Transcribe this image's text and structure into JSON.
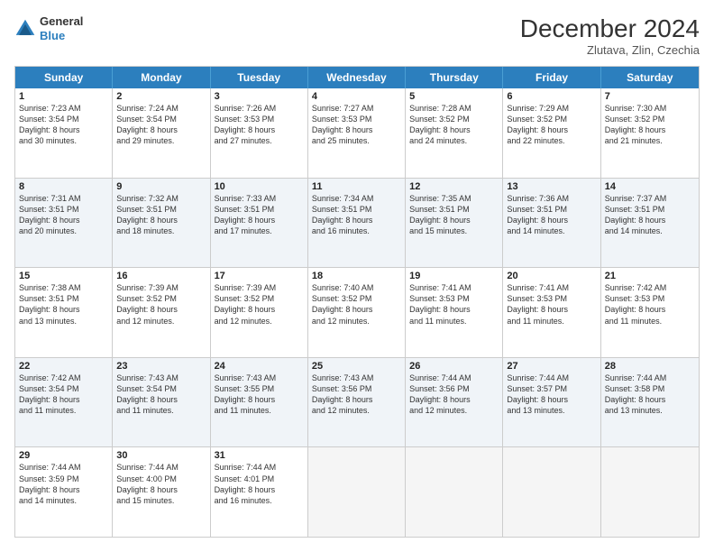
{
  "logo": {
    "general": "General",
    "blue": "Blue"
  },
  "title": "December 2024",
  "subtitle": "Zlutava, Zlin, Czechia",
  "header_days": [
    "Sunday",
    "Monday",
    "Tuesday",
    "Wednesday",
    "Thursday",
    "Friday",
    "Saturday"
  ],
  "weeks": [
    [
      {
        "day": "1",
        "lines": [
          "Sunrise: 7:23 AM",
          "Sunset: 3:54 PM",
          "Daylight: 8 hours",
          "and 30 minutes."
        ]
      },
      {
        "day": "2",
        "lines": [
          "Sunrise: 7:24 AM",
          "Sunset: 3:54 PM",
          "Daylight: 8 hours",
          "and 29 minutes."
        ]
      },
      {
        "day": "3",
        "lines": [
          "Sunrise: 7:26 AM",
          "Sunset: 3:53 PM",
          "Daylight: 8 hours",
          "and 27 minutes."
        ]
      },
      {
        "day": "4",
        "lines": [
          "Sunrise: 7:27 AM",
          "Sunset: 3:53 PM",
          "Daylight: 8 hours",
          "and 25 minutes."
        ]
      },
      {
        "day": "5",
        "lines": [
          "Sunrise: 7:28 AM",
          "Sunset: 3:52 PM",
          "Daylight: 8 hours",
          "and 24 minutes."
        ]
      },
      {
        "day": "6",
        "lines": [
          "Sunrise: 7:29 AM",
          "Sunset: 3:52 PM",
          "Daylight: 8 hours",
          "and 22 minutes."
        ]
      },
      {
        "day": "7",
        "lines": [
          "Sunrise: 7:30 AM",
          "Sunset: 3:52 PM",
          "Daylight: 8 hours",
          "and 21 minutes."
        ]
      }
    ],
    [
      {
        "day": "8",
        "lines": [
          "Sunrise: 7:31 AM",
          "Sunset: 3:51 PM",
          "Daylight: 8 hours",
          "and 20 minutes."
        ]
      },
      {
        "day": "9",
        "lines": [
          "Sunrise: 7:32 AM",
          "Sunset: 3:51 PM",
          "Daylight: 8 hours",
          "and 18 minutes."
        ]
      },
      {
        "day": "10",
        "lines": [
          "Sunrise: 7:33 AM",
          "Sunset: 3:51 PM",
          "Daylight: 8 hours",
          "and 17 minutes."
        ]
      },
      {
        "day": "11",
        "lines": [
          "Sunrise: 7:34 AM",
          "Sunset: 3:51 PM",
          "Daylight: 8 hours",
          "and 16 minutes."
        ]
      },
      {
        "day": "12",
        "lines": [
          "Sunrise: 7:35 AM",
          "Sunset: 3:51 PM",
          "Daylight: 8 hours",
          "and 15 minutes."
        ]
      },
      {
        "day": "13",
        "lines": [
          "Sunrise: 7:36 AM",
          "Sunset: 3:51 PM",
          "Daylight: 8 hours",
          "and 14 minutes."
        ]
      },
      {
        "day": "14",
        "lines": [
          "Sunrise: 7:37 AM",
          "Sunset: 3:51 PM",
          "Daylight: 8 hours",
          "and 14 minutes."
        ]
      }
    ],
    [
      {
        "day": "15",
        "lines": [
          "Sunrise: 7:38 AM",
          "Sunset: 3:51 PM",
          "Daylight: 8 hours",
          "and 13 minutes."
        ]
      },
      {
        "day": "16",
        "lines": [
          "Sunrise: 7:39 AM",
          "Sunset: 3:52 PM",
          "Daylight: 8 hours",
          "and 12 minutes."
        ]
      },
      {
        "day": "17",
        "lines": [
          "Sunrise: 7:39 AM",
          "Sunset: 3:52 PM",
          "Daylight: 8 hours",
          "and 12 minutes."
        ]
      },
      {
        "day": "18",
        "lines": [
          "Sunrise: 7:40 AM",
          "Sunset: 3:52 PM",
          "Daylight: 8 hours",
          "and 12 minutes."
        ]
      },
      {
        "day": "19",
        "lines": [
          "Sunrise: 7:41 AM",
          "Sunset: 3:53 PM",
          "Daylight: 8 hours",
          "and 11 minutes."
        ]
      },
      {
        "day": "20",
        "lines": [
          "Sunrise: 7:41 AM",
          "Sunset: 3:53 PM",
          "Daylight: 8 hours",
          "and 11 minutes."
        ]
      },
      {
        "day": "21",
        "lines": [
          "Sunrise: 7:42 AM",
          "Sunset: 3:53 PM",
          "Daylight: 8 hours",
          "and 11 minutes."
        ]
      }
    ],
    [
      {
        "day": "22",
        "lines": [
          "Sunrise: 7:42 AM",
          "Sunset: 3:54 PM",
          "Daylight: 8 hours",
          "and 11 minutes."
        ]
      },
      {
        "day": "23",
        "lines": [
          "Sunrise: 7:43 AM",
          "Sunset: 3:54 PM",
          "Daylight: 8 hours",
          "and 11 minutes."
        ]
      },
      {
        "day": "24",
        "lines": [
          "Sunrise: 7:43 AM",
          "Sunset: 3:55 PM",
          "Daylight: 8 hours",
          "and 11 minutes."
        ]
      },
      {
        "day": "25",
        "lines": [
          "Sunrise: 7:43 AM",
          "Sunset: 3:56 PM",
          "Daylight: 8 hours",
          "and 12 minutes."
        ]
      },
      {
        "day": "26",
        "lines": [
          "Sunrise: 7:44 AM",
          "Sunset: 3:56 PM",
          "Daylight: 8 hours",
          "and 12 minutes."
        ]
      },
      {
        "day": "27",
        "lines": [
          "Sunrise: 7:44 AM",
          "Sunset: 3:57 PM",
          "Daylight: 8 hours",
          "and 13 minutes."
        ]
      },
      {
        "day": "28",
        "lines": [
          "Sunrise: 7:44 AM",
          "Sunset: 3:58 PM",
          "Daylight: 8 hours",
          "and 13 minutes."
        ]
      }
    ],
    [
      {
        "day": "29",
        "lines": [
          "Sunrise: 7:44 AM",
          "Sunset: 3:59 PM",
          "Daylight: 8 hours",
          "and 14 minutes."
        ]
      },
      {
        "day": "30",
        "lines": [
          "Sunrise: 7:44 AM",
          "Sunset: 4:00 PM",
          "Daylight: 8 hours",
          "and 15 minutes."
        ]
      },
      {
        "day": "31",
        "lines": [
          "Sunrise: 7:44 AM",
          "Sunset: 4:01 PM",
          "Daylight: 8 hours",
          "and 16 minutes."
        ]
      },
      {
        "day": "",
        "lines": []
      },
      {
        "day": "",
        "lines": []
      },
      {
        "day": "",
        "lines": []
      },
      {
        "day": "",
        "lines": []
      }
    ]
  ]
}
